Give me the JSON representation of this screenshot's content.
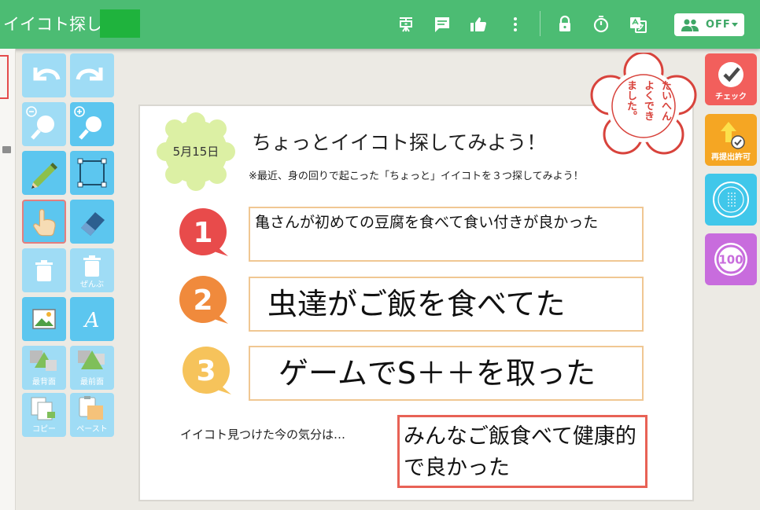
{
  "header": {
    "title": "イイコト探し：",
    "off_label": "OFF",
    "icons": [
      "whiteboard-icon",
      "comment-icon",
      "thumbs-up-icon",
      "more-vert-icon",
      "lock-icon",
      "timer-icon",
      "translate-icon",
      "people-icon"
    ]
  },
  "toolbar": {
    "delete_all_label": "ぜんぶ",
    "send_back_label": "最背面",
    "bring_front_label": "最前面",
    "copy_label": "コピー",
    "paste_label": "ペースト"
  },
  "actions": {
    "check_label": "チェック",
    "resubmit_label": "再提出許可"
  },
  "stamp": {
    "col1": "たいへん",
    "col2": "よくでき",
    "col3": "ました。"
  },
  "score_badge": "100",
  "worksheet": {
    "date": "5月15日",
    "heading": "ちょっとイイコト探してみよう！",
    "instructions": "※最近、身の回りで起こった「ちょっと」イイコトを３つ探してみよう！",
    "items": [
      {
        "number": "1",
        "text": "亀さんが初めての豆腐を食べて食い付きが良かった"
      },
      {
        "number": "2",
        "text": "虫達がご飯を食べてた"
      },
      {
        "number": "3",
        "text": "ゲームでS＋＋を取った"
      }
    ],
    "feeling_label": "イイコト見つけた今の気分は…",
    "feeling_text": "みんなご飯食べて健康的で良かった"
  },
  "colors": {
    "header_green": "#4cbc73",
    "tool_blue": "#5cc6ef",
    "check_red": "#f25f5c",
    "resubmit_orange": "#f5a623",
    "stamp_cyan": "#40c7ea",
    "score_purple": "#c86cdd",
    "badge1": "#e84b4b",
    "badge2": "#f08a3c",
    "badge3": "#f6c35b"
  }
}
